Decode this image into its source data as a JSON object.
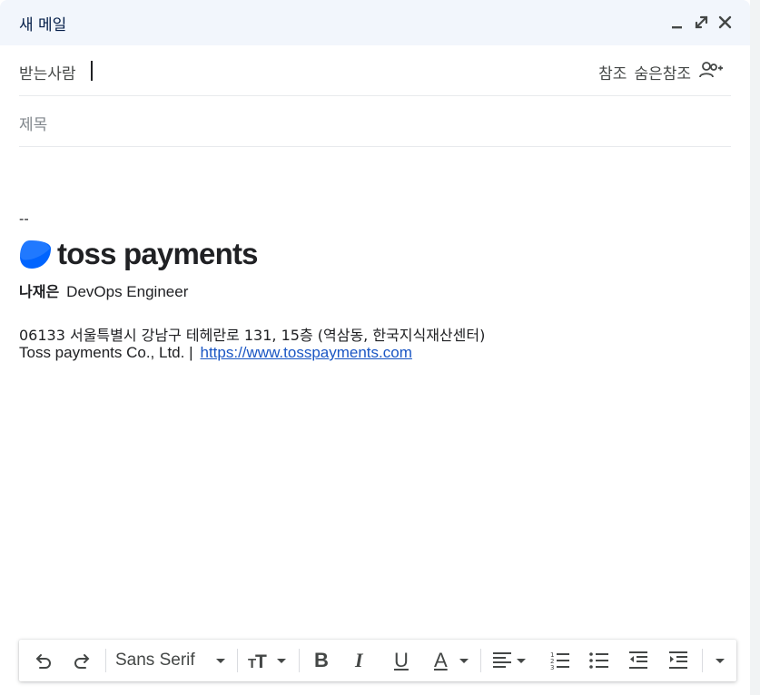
{
  "window": {
    "title": "새 메일"
  },
  "header": {
    "to_label": "받는사람",
    "cc_label": "참조",
    "bcc_label": "숨은참조",
    "subject_placeholder": "제목"
  },
  "signature": {
    "separator": "--",
    "logo_text": "toss payments",
    "name": "나재은",
    "role": "DevOps Engineer",
    "address": "06133 서울특별시 강남구 테헤란로 131, 15층 (역삼동, 한국지식재산센터)",
    "company": "Toss payments Co., Ltd. |",
    "website": "https://www.tosspayments.com"
  },
  "toolbar": {
    "font_family": "Sans Serif",
    "bold": "B",
    "italic": "I",
    "underline": "U",
    "text_color": "A"
  },
  "colors": {
    "titlebar": "#f2f6fc",
    "logo_blue": "#0064ff",
    "link": "#1a56c4"
  },
  "icons": [
    "minimize-icon",
    "expand-icon",
    "close-icon",
    "add-recipient-icon",
    "undo-icon",
    "redo-icon",
    "font-size-icon",
    "align-icon",
    "numbered-list-icon",
    "bulleted-list-icon",
    "indent-less-icon",
    "indent-more-icon",
    "more-options-icon"
  ]
}
